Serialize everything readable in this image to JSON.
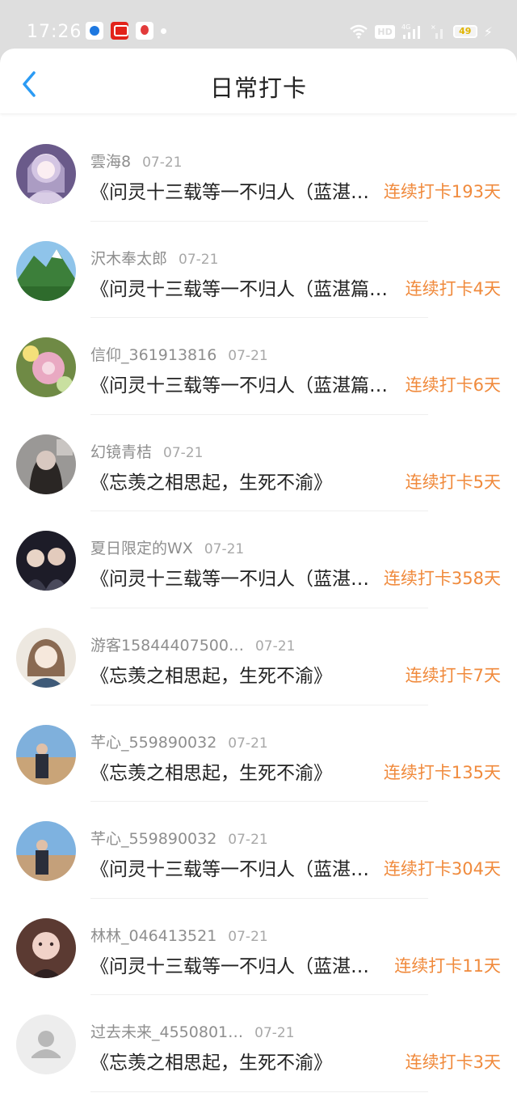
{
  "status_bar": {
    "time": "17:26",
    "network": "4G",
    "hd": "HD",
    "battery": "49"
  },
  "header": {
    "title": "日常打卡",
    "back_icon": "chevron-left-icon"
  },
  "colors": {
    "accent": "#2b9bf4",
    "streak": "#f08a3c"
  },
  "entries": [
    {
      "name": "雲海8",
      "date": "07-21",
      "text": "《问灵十三载等一不归人（蓝湛…",
      "streak": "连续打卡193天"
    },
    {
      "name": "沢木奉太郎",
      "date": "07-21",
      "text": "《问灵十三载等一不归人（蓝湛篇…",
      "streak": "连续打卡4天"
    },
    {
      "name": "信仰_361913816",
      "date": "07-21",
      "text": "《问灵十三载等一不归人（蓝湛篇…",
      "streak": "连续打卡6天"
    },
    {
      "name": "幻镜青桔",
      "date": "07-21",
      "text": "《忘羡之相思起，生死不渝》",
      "streak": "连续打卡5天"
    },
    {
      "name": "夏日限定的WX",
      "date": "07-21",
      "text": "《问灵十三载等一不归人（蓝湛…",
      "streak": "连续打卡358天"
    },
    {
      "name": "游客15844407500…",
      "date": "07-21",
      "text": "《忘羡之相思起，生死不渝》",
      "streak": "连续打卡7天"
    },
    {
      "name": "芊心_559890032",
      "date": "07-21",
      "text": "《忘羡之相思起，生死不渝》",
      "streak": "连续打卡135天"
    },
    {
      "name": "芊心_559890032",
      "date": "07-21",
      "text": "《问灵十三载等一不归人（蓝湛…",
      "streak": "连续打卡304天"
    },
    {
      "name": "林林_046413521",
      "date": "07-21",
      "text": "《问灵十三载等一不归人（蓝湛…",
      "streak": "连续打卡11天"
    },
    {
      "name": "过去未来_4550801…",
      "date": "07-21",
      "text": "《忘羡之相思起，生死不渝》",
      "streak": "连续打卡3天"
    }
  ]
}
